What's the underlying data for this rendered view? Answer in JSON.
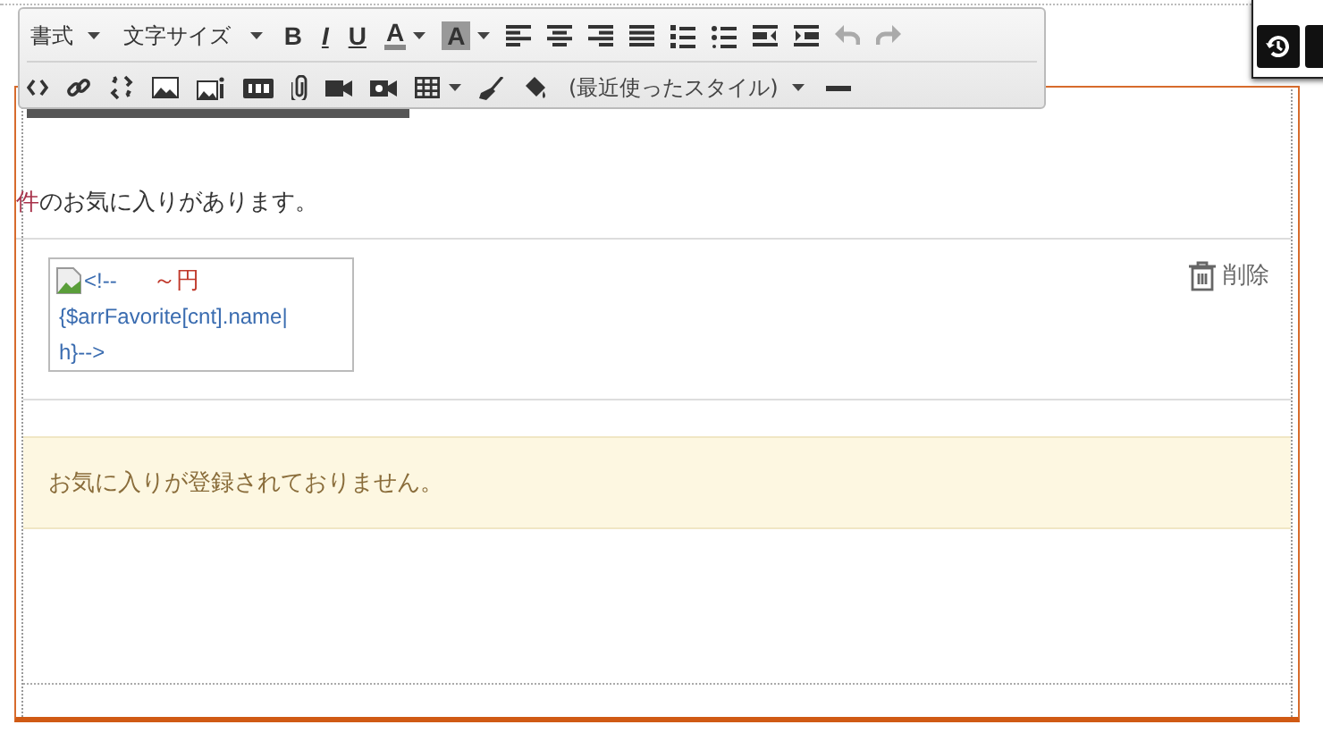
{
  "toolbar": {
    "format_dropdown": "書式",
    "size_dropdown": "文字サイズ",
    "bold": "B",
    "italic": "I",
    "underline": "U",
    "text_color": "A",
    "bg_color": "A",
    "undo": {
      "disabled": true
    },
    "redo": {
      "disabled": true
    },
    "styles_dropdown": "(最近使ったスタイル)"
  },
  "message": {
    "count_unit": "件",
    "text": "のお気に入りがあります。"
  },
  "favorite": {
    "alt_lines": [
      "<!--",
      "{$arrFavorite[cnt].name|",
      "h}-->"
    ],
    "price": "～円",
    "delete_label": "削除"
  },
  "empty_notice": "お気に入りが登録されておりません。"
}
